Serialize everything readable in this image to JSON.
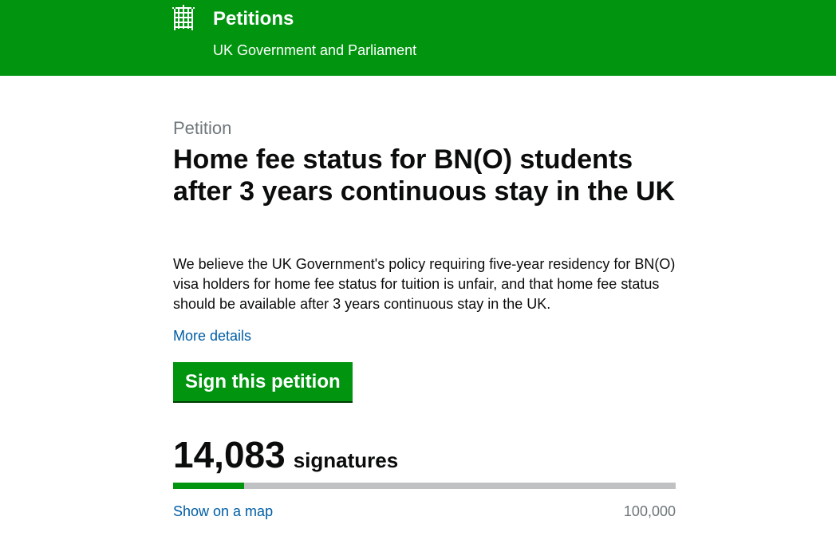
{
  "header": {
    "title": "Petitions",
    "subtitle": "UK Government and Parliament",
    "logo_icon": "portcullis-icon",
    "background_color": "#00940f"
  },
  "petition": {
    "caption": "Petition",
    "title": "Home fee status for BN(O) students after 3 years continuous stay in the UK",
    "summary": "We believe the UK Government's policy requiring five-year residency for BN(O) visa holders for home fee status for tuition is unfair, and that home fee status should be available after 3 years continuous stay in the UK.",
    "more_details_label": "More details",
    "sign_button_label": "Sign this petition"
  },
  "signatures": {
    "count": "14,083",
    "label": "signatures",
    "progress_fraction": 0.14083,
    "target": "100,000",
    "map_link_label": "Show on a map"
  },
  "colors": {
    "brand_green": "#00940f",
    "link_blue": "#005ea5",
    "secondary_text": "#6f777b",
    "progress_track": "#bfc1c3"
  }
}
